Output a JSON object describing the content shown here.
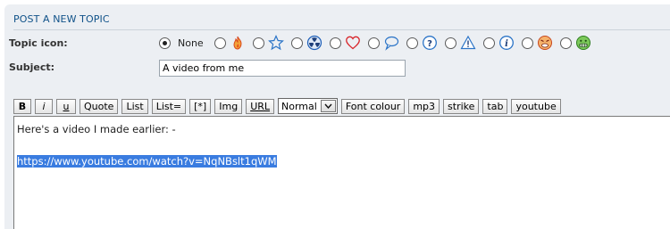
{
  "section_title": "POST A NEW TOPIC",
  "topic_icon": {
    "label": "Topic icon:",
    "none_label": "None",
    "selected": "none",
    "options": [
      {
        "name": "fire-icon",
        "color": "#e8541e"
      },
      {
        "name": "star-icon",
        "color": "#2b74c7"
      },
      {
        "name": "radioactive-icon",
        "color": "#1e5fb8"
      },
      {
        "name": "heart-icon",
        "color": "#d8262b"
      },
      {
        "name": "speech-bubble-icon",
        "color": "#2b74c7"
      },
      {
        "name": "question-icon",
        "color": "#2b74c7"
      },
      {
        "name": "warning-icon",
        "color": "#2b74c7"
      },
      {
        "name": "info-icon",
        "color": "#2b74c7"
      },
      {
        "name": "mad-face-icon",
        "color": "#e0582d"
      },
      {
        "name": "grin-face-icon",
        "color": "#3fa62e"
      }
    ]
  },
  "subject": {
    "label": "Subject:",
    "value": "A video from me"
  },
  "toolbar": {
    "bold": "B",
    "italic": "i",
    "underline": "u",
    "quote": "Quote",
    "list": "List",
    "list_ordered": "List=",
    "list_item": "[*]",
    "img": "Img",
    "url": "URL",
    "font_size": "Normal",
    "font_colour": "Font colour",
    "mp3": "mp3",
    "strike": "strike",
    "tab": "tab",
    "youtube": "youtube"
  },
  "editor": {
    "line1": "Here's a video I made earlier: -",
    "line2": "",
    "line3_selected": "https://www.youtube.com/watch?v=NqNBslt1qWM"
  }
}
